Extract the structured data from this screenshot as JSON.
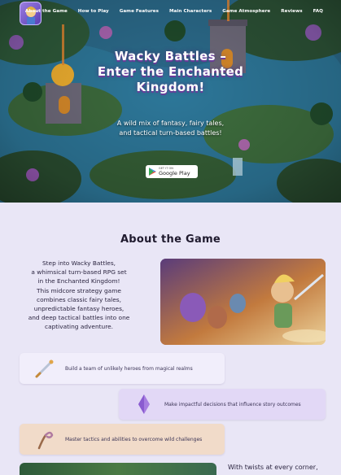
{
  "nav": {
    "links": [
      "About the Game",
      "How to Play",
      "Game Features",
      "Main Characters",
      "Game Atmosphere",
      "Reviews",
      "FAQ"
    ]
  },
  "hero": {
    "title_line1": "Wacky Battles –",
    "title_line2": "Enter the Enchanted",
    "title_line3": "Kingdom!",
    "subtitle_line1": "A wild mix of fantasy, fairy tales,",
    "subtitle_line2": "and tactical turn-based battles!",
    "store_button": {
      "small": "GET IT ON",
      "big": "Google Play"
    }
  },
  "about": {
    "title": "About the Game",
    "paragraph_lines": [
      "Step into Wacky Battles,",
      "a whimsical turn-based RPG set",
      "in the Enchanted Kingdom!",
      "This midcore strategy game",
      "combines classic fairy tales,",
      "unpredictable fantasy heroes,",
      "and deep tactical battles into one",
      "captivating adventure."
    ]
  },
  "features": [
    {
      "label": "Build a team of unlikely heroes from magical realms",
      "icon": "sword-icon"
    },
    {
      "label": "Make impactful decisions that influence story outcomes",
      "icon": "crystal-icon"
    },
    {
      "label": "Master tactics and abilities to overcome wild challenges",
      "icon": "staff-icon"
    }
  ],
  "bottom": {
    "text": "With twists at every corner,"
  },
  "colors": {
    "page_bg": "#e9e6f6",
    "accent_purple": "#6b3b9a",
    "feature2_bg": "#e2d8f6",
    "feature3_bg": "#f1dbc9"
  }
}
